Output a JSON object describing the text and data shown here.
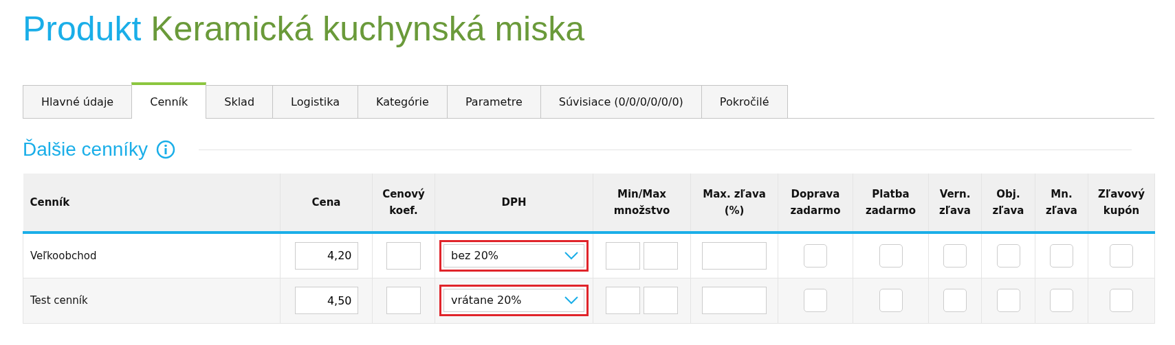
{
  "title": {
    "prefix": "Produkt",
    "name": "Keramická kuchynská miska"
  },
  "tabs": [
    {
      "label": "Hlavné údaje",
      "selected": false
    },
    {
      "label": "Cenník",
      "selected": true
    },
    {
      "label": "Sklad",
      "selected": false
    },
    {
      "label": "Logistika",
      "selected": false
    },
    {
      "label": "Kategórie",
      "selected": false
    },
    {
      "label": "Parametre",
      "selected": false
    },
    {
      "label": "Súvisiace (0/0/0/0/0/0)",
      "selected": false
    },
    {
      "label": "Pokročilé",
      "selected": false
    }
  ],
  "section": {
    "title": "Ďalšie cenníky"
  },
  "table": {
    "columns": [
      "Cenník",
      "Cena",
      "Cenový koef.",
      "DPH",
      "Min/Max množstvo",
      "Max. zľava (%)",
      "Doprava zadarmo",
      "Platba zadarmo",
      "Vern. zľava",
      "Obj. zľava",
      "Mn. zľava",
      "Zľavový kupón"
    ],
    "rows": [
      {
        "name": "Veľkoobchod",
        "price": "4,20",
        "vat": "bez 20%",
        "highlighted": true,
        "flags": [
          {
            "checked": false
          },
          {
            "checked": false
          },
          {
            "checked": false
          },
          {
            "checked": false
          },
          {
            "checked": false
          },
          {
            "checked": false
          }
        ]
      },
      {
        "name": "Test cenník",
        "price": "4,50",
        "vat": "vrátane 20%",
        "highlighted": true,
        "flags": [
          {
            "checked": false
          },
          {
            "checked": false
          },
          {
            "checked": false
          },
          {
            "checked": false
          },
          {
            "checked": false
          },
          {
            "checked": false
          }
        ]
      }
    ]
  }
}
